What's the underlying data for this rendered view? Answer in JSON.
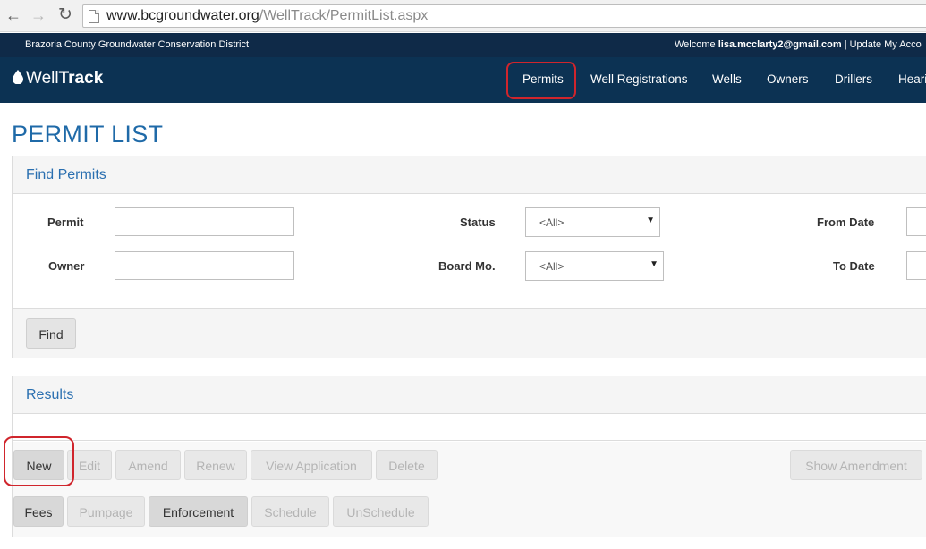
{
  "browser": {
    "url_host": "www.bcgroundwater.org",
    "url_path": "/WellTrack/PermitList.aspx"
  },
  "top_bar": {
    "district": "Brazoria County Groundwater Conservation District",
    "welcome_prefix": "Welcome",
    "user_email": "lisa.mcclarty2@gmail.com",
    "separator": "|",
    "account_link": "Update My Acco"
  },
  "nav": {
    "logo_part1": "Well",
    "logo_part2": "Track",
    "items": [
      {
        "label": "Permits"
      },
      {
        "label": "Well Registrations"
      },
      {
        "label": "Wells"
      },
      {
        "label": "Owners"
      },
      {
        "label": "Drillers"
      },
      {
        "label": "Hearin"
      }
    ]
  },
  "page": {
    "title": "PERMIT LIST"
  },
  "find": {
    "heading": "Find Permits",
    "permit_label": "Permit",
    "permit_value": "",
    "owner_label": "Owner",
    "owner_value": "",
    "status_label": "Status",
    "status_value": "<All>",
    "board_label": "Board Mo.",
    "board_value": "<All>",
    "from_label": "From Date",
    "to_label": "To Date",
    "find_button": "Find"
  },
  "results": {
    "heading": "Results",
    "row1": [
      "New",
      "Edit",
      "Amend",
      "Renew",
      "View Application",
      "Delete"
    ],
    "show_amendment": "Show Amendment",
    "row2": [
      "Fees",
      "Pumpage",
      "Enforcement",
      "Schedule",
      "UnSchedule"
    ]
  },
  "colors": {
    "nav_bg": "#0c3253",
    "top_bar_bg": "#0f2a48",
    "accent_blue": "#1f6aa8",
    "highlight_red": "#d0252c"
  }
}
